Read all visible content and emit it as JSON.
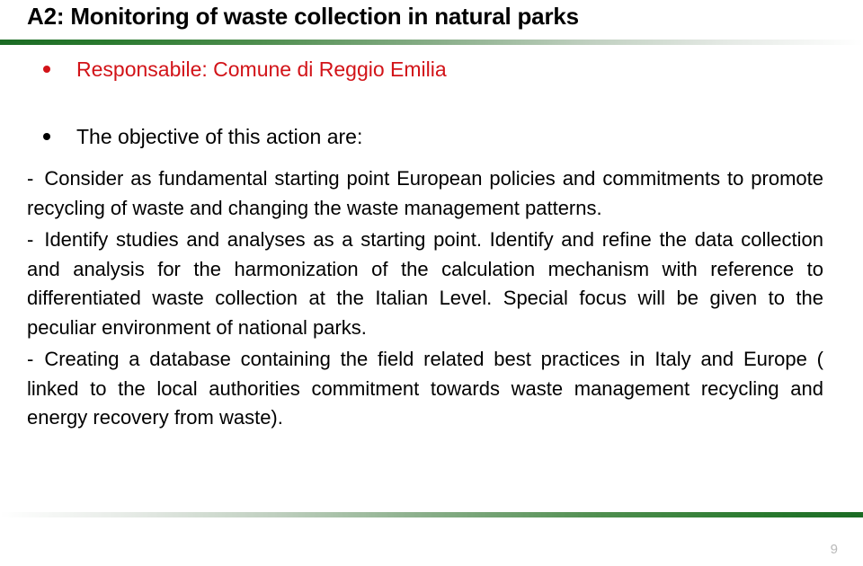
{
  "slide": {
    "title": "A2: Monitoring of waste collection in natural parks",
    "page_number": "9",
    "accent_green": "#1b6b24",
    "accent_red": "#d21318",
    "page_number_color": "#b9b9b9"
  },
  "bullets": [
    {
      "text": "Responsabile: Comune di Reggio Emilia",
      "color": "#d21318",
      "marker": "bullet-dot"
    },
    {
      "text": "The objective of this action are:",
      "color": "#000000",
      "marker": "bullet-dot"
    }
  ],
  "paragraphs": [
    {
      "dash": "-",
      "text": "Consider as fundamental starting point European policies and commitments to promote recycling of waste and changing the waste management patterns."
    },
    {
      "dash": "-",
      "text": "Identify studies and analyses as a starting point. Identify  and refine the data collection and analysis for the harmonization of the calculation mechanism with reference to differentiated waste collection at the Italian Level. Special focus will be given to the peculiar environment of national parks."
    },
    {
      "dash": "-",
      "text": "Creating a database containing the field related best practices in Italy and Europe  ( linked to the local authorities commitment towards waste management recycling and energy recovery from waste)."
    }
  ]
}
